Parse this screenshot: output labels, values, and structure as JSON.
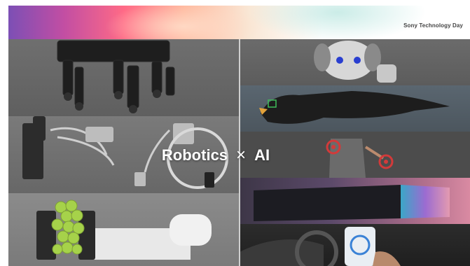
{
  "header": {
    "brand": "Sony Technology Day"
  },
  "headline": {
    "left": "Robotics",
    "symbol": "×",
    "right": "AI"
  },
  "tiles": [
    {
      "name": "quadruped-robot-tile"
    },
    {
      "name": "robotic-arms-tile"
    },
    {
      "name": "grape-grasping-robot-tile"
    },
    {
      "name": "aibo-dog-tile"
    },
    {
      "name": "eagle-tile"
    },
    {
      "name": "person-tracking-tile"
    },
    {
      "name": "display-tile"
    },
    {
      "name": "car-phone-tile"
    }
  ],
  "colors": {
    "highlight_red": "#d23a3a",
    "highlight_green": "#3fbf5a",
    "grape_green": "#a6d24a"
  }
}
